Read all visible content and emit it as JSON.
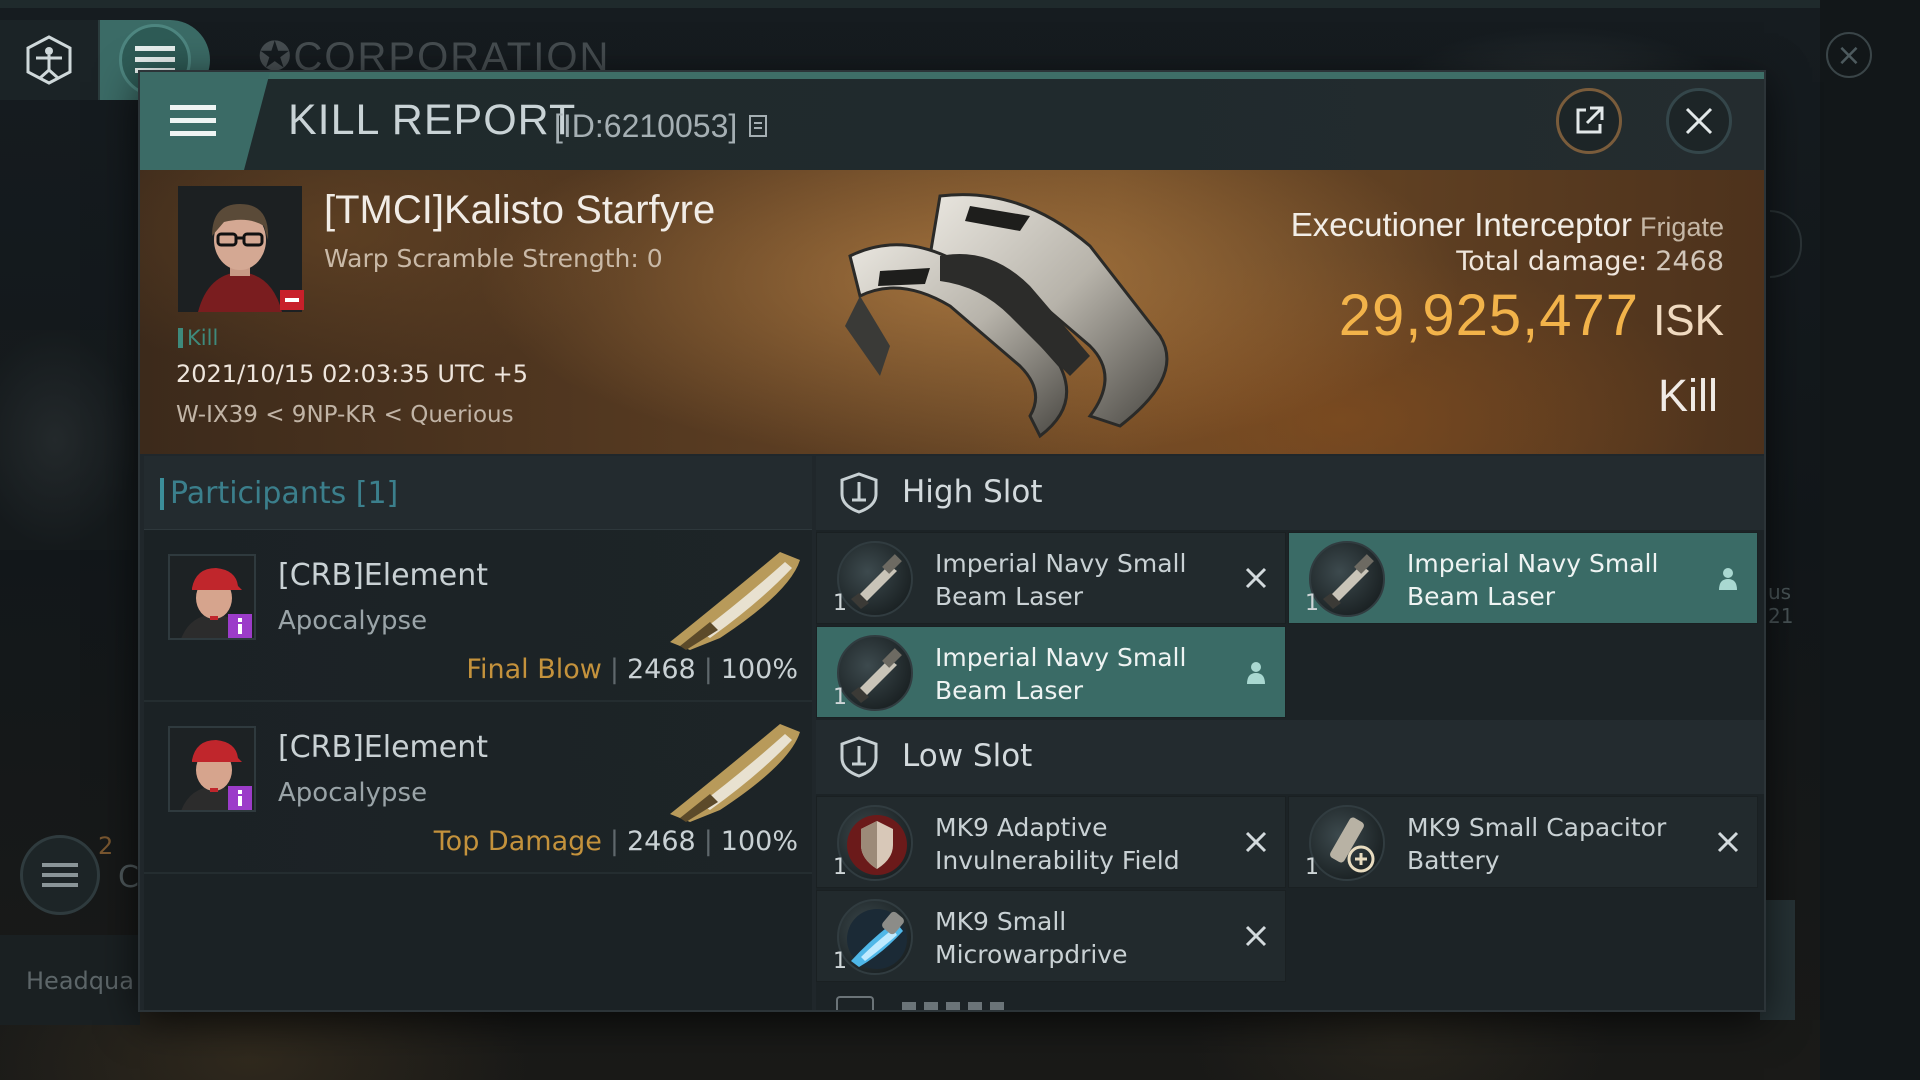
{
  "background": {
    "title": "CORPORATION",
    "left_count": "2",
    "left_letter": "C",
    "headquarters_label": "Headqua",
    "right_text_1": "us",
    "right_text_2": "21"
  },
  "dialog": {
    "title": "KILL REPORT",
    "report_id": "[ID:6210053]"
  },
  "victim": {
    "name": "[TMCI]Kalisto Starfyre",
    "warp_scramble": "Warp Scramble Strength: 0",
    "result_tag": "Kill",
    "datetime": "2021/10/15 02:03:35 UTC +5",
    "location": "W-IX39 < 9NP-KR < Querious"
  },
  "ship": {
    "name": "Executioner Interceptor",
    "class": "Frigate",
    "total_damage_label": "Total damage:",
    "total_damage_value": "2468",
    "isk_value": "29,925,477",
    "isk_unit": "ISK",
    "result_label": "Kill"
  },
  "participants": {
    "header": "Participants [1]",
    "rows": [
      {
        "name": "[CRB]Element",
        "ship": "Apocalypse",
        "role": "Final Blow",
        "damage": "2468",
        "percent": "100%"
      },
      {
        "name": "[CRB]Element",
        "ship": "Apocalypse",
        "role": "Top Damage",
        "damage": "2468",
        "percent": "100%"
      }
    ]
  },
  "fittings": {
    "high_slot_label": "High Slot",
    "low_slot_label": "Low Slot",
    "high_slot": [
      {
        "name": "Imperial Navy Small Beam Laser",
        "qty": "1",
        "state": "destroyed"
      },
      {
        "name": "Imperial Navy Small Beam Laser",
        "qty": "1",
        "state": "dropped"
      },
      {
        "name": "Imperial Navy Small Beam Laser",
        "qty": "1",
        "state": "dropped"
      }
    ],
    "low_slot": [
      {
        "name": "MK9 Adaptive Invulnerability Field",
        "qty": "1",
        "state": "destroyed"
      },
      {
        "name": "MK9 Small Capacitor Battery",
        "qty": "1",
        "state": "destroyed"
      },
      {
        "name": "MK9 Small Microwarpdrive",
        "qty": "1",
        "state": "destroyed"
      }
    ]
  },
  "icons": {
    "logo": "vitruvian-logo-icon",
    "menu": "hamburger-menu-icon",
    "share": "share-external-icon",
    "close": "close-icon",
    "copy": "copy-icon",
    "shield": "slot-shield-icon",
    "destroyed": "x-mark-icon",
    "dropped": "person-icon"
  },
  "colors": {
    "accent_teal": "#3b6b66",
    "isk_gold": "#f2b34a",
    "role_orange": "#c4923c",
    "participants_blue": "#3b7f8c",
    "victim_badge_red": "#c8202a",
    "attacker_badge_purple": "#9c3cc9"
  }
}
